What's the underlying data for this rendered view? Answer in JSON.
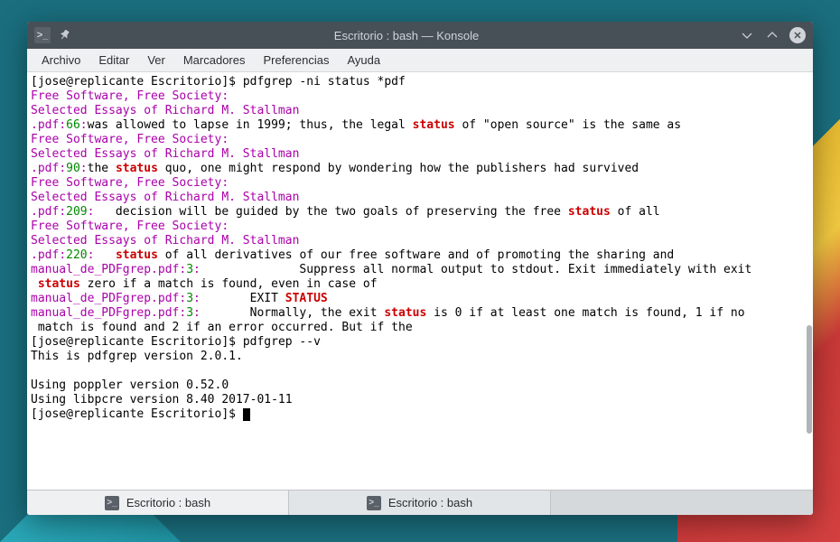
{
  "window": {
    "title": "Escritorio : bash — Konsole"
  },
  "menubar": {
    "items": [
      "Archivo",
      "Editar",
      "Ver",
      "Marcadores",
      "Preferencias",
      "Ayuda"
    ]
  },
  "tabs": [
    {
      "label": "Escritorio : bash",
      "active": true
    },
    {
      "label": "Escritorio : bash",
      "active": false
    }
  ],
  "terminal": {
    "prompt1": "[jose@replicante Escritorio]$ ",
    "cmd1": "pdfgrep -ni status *pdf",
    "free1": "Free Software, Free Society:",
    "essays1": "Selected Essays of Richard M. Stallman",
    "pdf1_file": ".pdf",
    "pdf1_colon1": ":",
    "pdf1_line": "66",
    "pdf1_colon2": ":",
    "pdf1_text_a": "was allowed to lapse in 1999; thus, the legal ",
    "pdf1_match": "status",
    "pdf1_text_b": " of \"open source\" is the same as",
    "free2": "Free Software, Free Society:",
    "essays2": "Selected Essays of Richard M. Stallman",
    "pdf2_file": ".pdf",
    "pdf2_colon1": ":",
    "pdf2_line": "90",
    "pdf2_colon2": ":",
    "pdf2_text_a": "the ",
    "pdf2_match": "status",
    "pdf2_text_b": " quo, one might respond by wondering how the publishers had survived",
    "free3": "Free Software, Free Society:",
    "essays3": "Selected Essays of Richard M. Stallman",
    "pdf3_file": ".pdf",
    "pdf3_colon1": ":",
    "pdf3_line": "209",
    "pdf3_colon2": ":",
    "pdf3_text_a": "   decision will be guided by the two goals of preserving the free ",
    "pdf3_match": "status",
    "pdf3_text_b": " of all",
    "free4": "Free Software, Free Society:",
    "essays4": "Selected Essays of Richard M. Stallman",
    "pdf4_file": ".pdf",
    "pdf4_colon1": ":",
    "pdf4_line": "220",
    "pdf4_colon2": ":",
    "pdf4_text_a": "   ",
    "pdf4_match": "status",
    "pdf4_text_b": " of all derivatives of our free software and of promoting the sharing and",
    "man1_file": "manual_de_PDFgrep.pdf",
    "man1_colon1": ":",
    "man1_line": "3",
    "man1_colon2": ":",
    "man1_text_a": "              Suppress all normal output to stdout. Exit immediately with exit",
    "man1b_text_a": " ",
    "man1b_match": "status",
    "man1b_text_b": " zero if a match is found, even in case of",
    "man2_file": "manual_de_PDFgrep.pdf",
    "man2_colon1": ":",
    "man2_line": "3",
    "man2_colon2": ":",
    "man2_text_a": "       EXIT ",
    "man2_match": "STATUS",
    "man3_file": "manual_de_PDFgrep.pdf",
    "man3_colon1": ":",
    "man3_line": "3",
    "man3_colon2": ":",
    "man3_text_a": "       Normally, the exit ",
    "man3_match": "status",
    "man3_text_b": " is 0 if at least one match is found, 1 if no",
    "man3b_text": " match is found and 2 if an error occurred. But if the",
    "prompt2": "[jose@replicante Escritorio]$ ",
    "cmd2": "pdfgrep --v",
    "ver1": "This is pdfgrep version 2.0.1.",
    "blank": "",
    "ver2": "Using poppler version 0.52.0",
    "ver3": "Using libpcre version 8.40 2017-01-11",
    "prompt3": "[jose@replicante Escritorio]$ "
  }
}
